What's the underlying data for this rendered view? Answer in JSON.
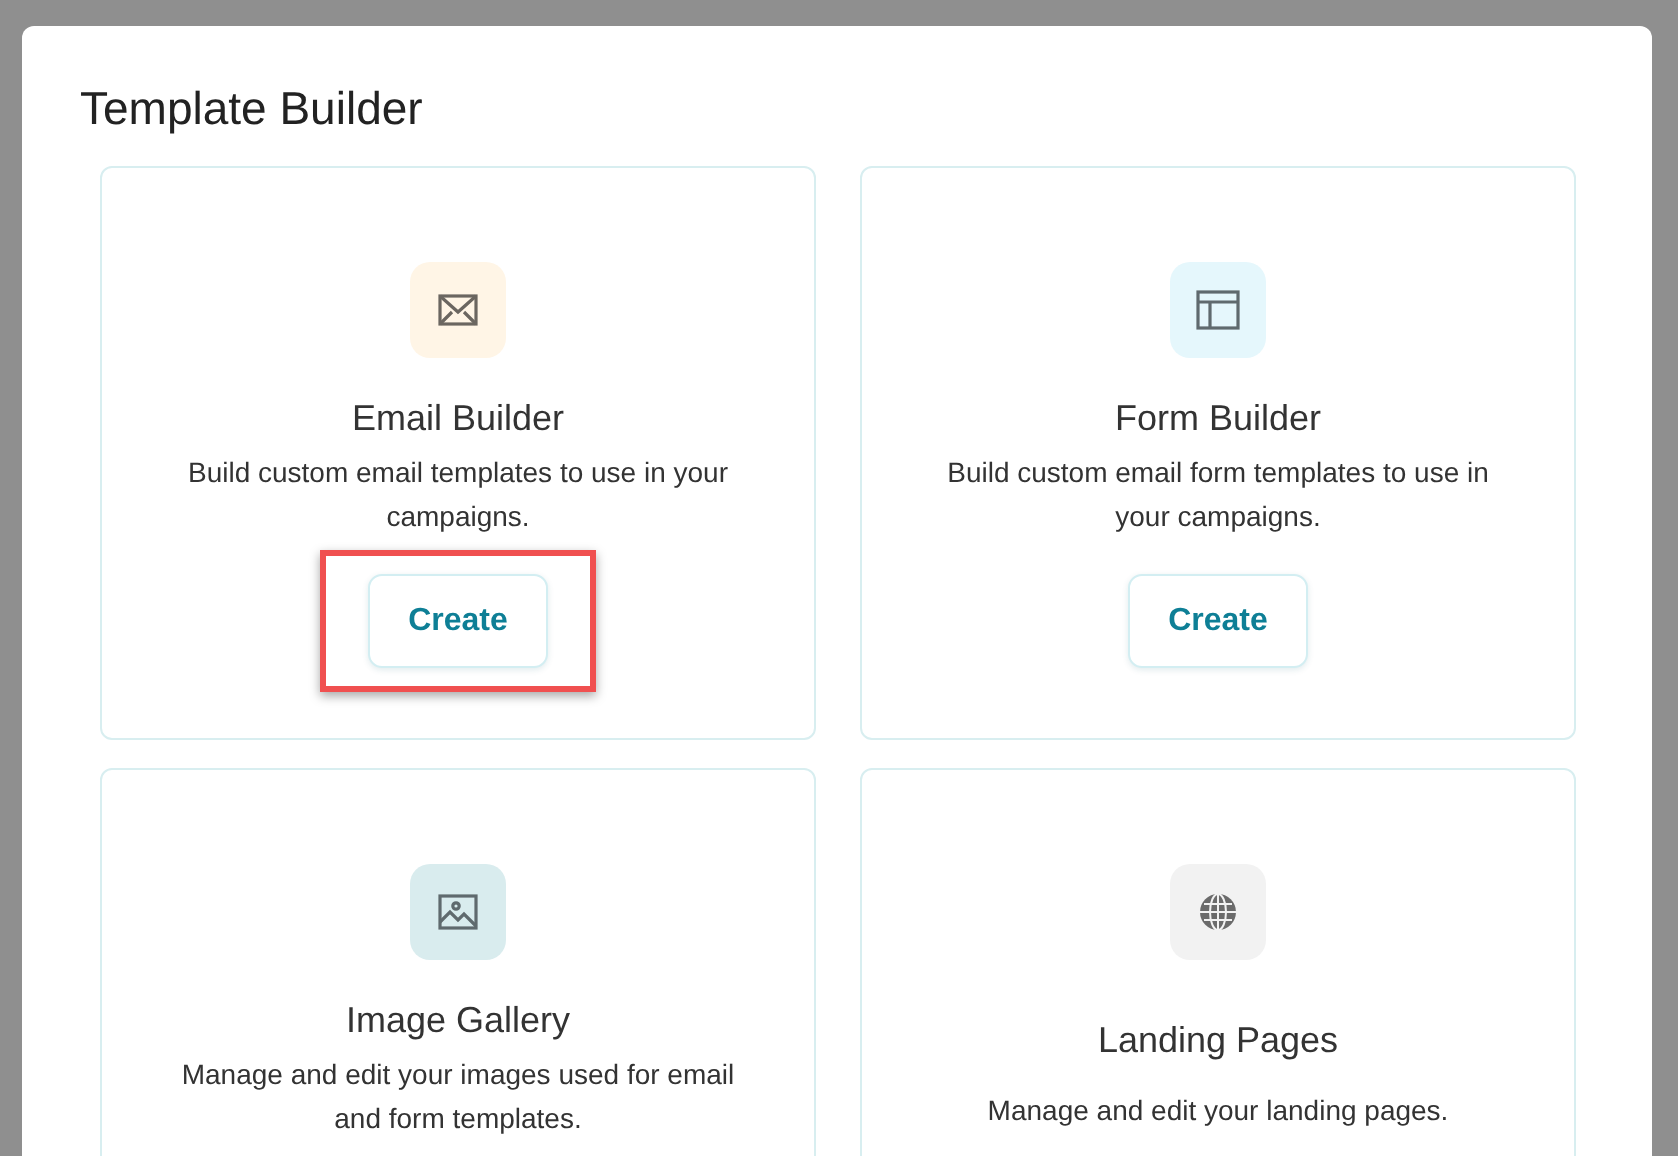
{
  "dialog": {
    "title": "Template Builder"
  },
  "cards": [
    {
      "kind": "email",
      "title": "Email Builder",
      "description": "Build custom email templates to use in your campaigns.",
      "color": "#fff5e6",
      "button": {
        "label": "Create",
        "highlighted": true
      }
    },
    {
      "kind": "form",
      "title": "Form Builder",
      "description": "Build custom email form templates to use in your campaigns.",
      "color": "#e5f7fc",
      "button": {
        "label": "Create",
        "highlighted": false
      }
    },
    {
      "kind": "image",
      "title": "Image Gallery",
      "description": "Manage and edit your images used for email and form templates."
    },
    {
      "kind": "landing",
      "title": "Landing Pages",
      "description": "Manage and edit your landing pages."
    }
  ]
}
